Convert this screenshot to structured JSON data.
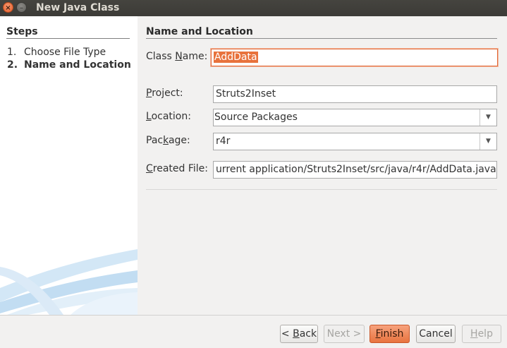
{
  "window": {
    "title": "New Java Class"
  },
  "steps": {
    "heading": "Steps",
    "items": [
      {
        "num": "1.",
        "label": "Choose File Type"
      },
      {
        "num": "2.",
        "label": "Name and Location"
      }
    ]
  },
  "form": {
    "section_title": "Name and Location",
    "class_name": {
      "label_pre": "Class ",
      "label_mn": "N",
      "label_post": "ame:",
      "value": "AddData"
    },
    "project": {
      "label_mn": "P",
      "label_post": "roject:",
      "value": "Struts2Inset"
    },
    "location": {
      "label_mn": "L",
      "label_post": "ocation:",
      "value": "Source Packages"
    },
    "package": {
      "label_pre": "Pac",
      "label_mn": "k",
      "label_post": "age:",
      "value": "r4r"
    },
    "created_file": {
      "label_mn": "C",
      "label_post": "reated File:",
      "value": "urrent application/Struts2Inset/src/java/r4r/AddData.java"
    }
  },
  "buttons": {
    "back": {
      "pre": "< ",
      "mn": "B",
      "post": "ack"
    },
    "next": "Next >",
    "finish": {
      "mn": "F",
      "post": "inish"
    },
    "cancel": "Cancel",
    "help": {
      "mn": "H",
      "post": "elp"
    }
  },
  "colors": {
    "accent": "#e8723c",
    "titlebar": "#3c3b37",
    "panel": "#f2f1f0"
  }
}
